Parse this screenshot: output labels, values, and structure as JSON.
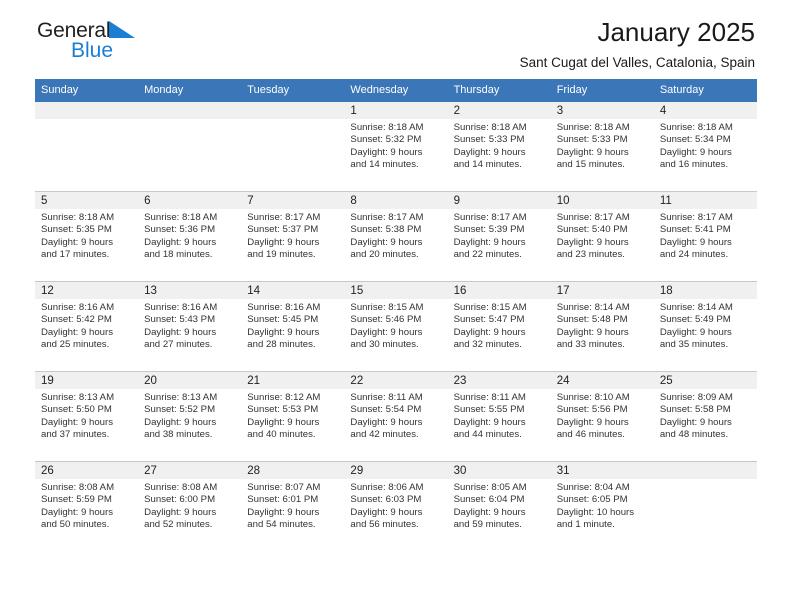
{
  "brand": {
    "name_dark": "General",
    "name_light": "Blue",
    "triangle_color": "#1a7fd4"
  },
  "header": {
    "title": "January 2025",
    "subtitle": "Sant Cugat del Valles, Catalonia, Spain"
  },
  "theme": {
    "header_bg": "#3a76b8",
    "daynum_bg": "#f0f0f0",
    "grid_line": "#c8c8c8",
    "text": "#333333"
  },
  "weekdays": [
    "Sunday",
    "Monday",
    "Tuesday",
    "Wednesday",
    "Thursday",
    "Friday",
    "Saturday"
  ],
  "weeks": [
    [
      {
        "day": "",
        "empty": true,
        "sunrise": "",
        "sunset": "",
        "daylight1": "",
        "daylight2": ""
      },
      {
        "day": "",
        "empty": true,
        "sunrise": "",
        "sunset": "",
        "daylight1": "",
        "daylight2": ""
      },
      {
        "day": "",
        "empty": true,
        "sunrise": "",
        "sunset": "",
        "daylight1": "",
        "daylight2": ""
      },
      {
        "day": "1",
        "empty": false,
        "sunrise": "Sunrise: 8:18 AM",
        "sunset": "Sunset: 5:32 PM",
        "daylight1": "Daylight: 9 hours",
        "daylight2": "and 14 minutes."
      },
      {
        "day": "2",
        "empty": false,
        "sunrise": "Sunrise: 8:18 AM",
        "sunset": "Sunset: 5:33 PM",
        "daylight1": "Daylight: 9 hours",
        "daylight2": "and 14 minutes."
      },
      {
        "day": "3",
        "empty": false,
        "sunrise": "Sunrise: 8:18 AM",
        "sunset": "Sunset: 5:33 PM",
        "daylight1": "Daylight: 9 hours",
        "daylight2": "and 15 minutes."
      },
      {
        "day": "4",
        "empty": false,
        "sunrise": "Sunrise: 8:18 AM",
        "sunset": "Sunset: 5:34 PM",
        "daylight1": "Daylight: 9 hours",
        "daylight2": "and 16 minutes."
      }
    ],
    [
      {
        "day": "5",
        "empty": false,
        "sunrise": "Sunrise: 8:18 AM",
        "sunset": "Sunset: 5:35 PM",
        "daylight1": "Daylight: 9 hours",
        "daylight2": "and 17 minutes."
      },
      {
        "day": "6",
        "empty": false,
        "sunrise": "Sunrise: 8:18 AM",
        "sunset": "Sunset: 5:36 PM",
        "daylight1": "Daylight: 9 hours",
        "daylight2": "and 18 minutes."
      },
      {
        "day": "7",
        "empty": false,
        "sunrise": "Sunrise: 8:17 AM",
        "sunset": "Sunset: 5:37 PM",
        "daylight1": "Daylight: 9 hours",
        "daylight2": "and 19 minutes."
      },
      {
        "day": "8",
        "empty": false,
        "sunrise": "Sunrise: 8:17 AM",
        "sunset": "Sunset: 5:38 PM",
        "daylight1": "Daylight: 9 hours",
        "daylight2": "and 20 minutes."
      },
      {
        "day": "9",
        "empty": false,
        "sunrise": "Sunrise: 8:17 AM",
        "sunset": "Sunset: 5:39 PM",
        "daylight1": "Daylight: 9 hours",
        "daylight2": "and 22 minutes."
      },
      {
        "day": "10",
        "empty": false,
        "sunrise": "Sunrise: 8:17 AM",
        "sunset": "Sunset: 5:40 PM",
        "daylight1": "Daylight: 9 hours",
        "daylight2": "and 23 minutes."
      },
      {
        "day": "11",
        "empty": false,
        "sunrise": "Sunrise: 8:17 AM",
        "sunset": "Sunset: 5:41 PM",
        "daylight1": "Daylight: 9 hours",
        "daylight2": "and 24 minutes."
      }
    ],
    [
      {
        "day": "12",
        "empty": false,
        "sunrise": "Sunrise: 8:16 AM",
        "sunset": "Sunset: 5:42 PM",
        "daylight1": "Daylight: 9 hours",
        "daylight2": "and 25 minutes."
      },
      {
        "day": "13",
        "empty": false,
        "sunrise": "Sunrise: 8:16 AM",
        "sunset": "Sunset: 5:43 PM",
        "daylight1": "Daylight: 9 hours",
        "daylight2": "and 27 minutes."
      },
      {
        "day": "14",
        "empty": false,
        "sunrise": "Sunrise: 8:16 AM",
        "sunset": "Sunset: 5:45 PM",
        "daylight1": "Daylight: 9 hours",
        "daylight2": "and 28 minutes."
      },
      {
        "day": "15",
        "empty": false,
        "sunrise": "Sunrise: 8:15 AM",
        "sunset": "Sunset: 5:46 PM",
        "daylight1": "Daylight: 9 hours",
        "daylight2": "and 30 minutes."
      },
      {
        "day": "16",
        "empty": false,
        "sunrise": "Sunrise: 8:15 AM",
        "sunset": "Sunset: 5:47 PM",
        "daylight1": "Daylight: 9 hours",
        "daylight2": "and 32 minutes."
      },
      {
        "day": "17",
        "empty": false,
        "sunrise": "Sunrise: 8:14 AM",
        "sunset": "Sunset: 5:48 PM",
        "daylight1": "Daylight: 9 hours",
        "daylight2": "and 33 minutes."
      },
      {
        "day": "18",
        "empty": false,
        "sunrise": "Sunrise: 8:14 AM",
        "sunset": "Sunset: 5:49 PM",
        "daylight1": "Daylight: 9 hours",
        "daylight2": "and 35 minutes."
      }
    ],
    [
      {
        "day": "19",
        "empty": false,
        "sunrise": "Sunrise: 8:13 AM",
        "sunset": "Sunset: 5:50 PM",
        "daylight1": "Daylight: 9 hours",
        "daylight2": "and 37 minutes."
      },
      {
        "day": "20",
        "empty": false,
        "sunrise": "Sunrise: 8:13 AM",
        "sunset": "Sunset: 5:52 PM",
        "daylight1": "Daylight: 9 hours",
        "daylight2": "and 38 minutes."
      },
      {
        "day": "21",
        "empty": false,
        "sunrise": "Sunrise: 8:12 AM",
        "sunset": "Sunset: 5:53 PM",
        "daylight1": "Daylight: 9 hours",
        "daylight2": "and 40 minutes."
      },
      {
        "day": "22",
        "empty": false,
        "sunrise": "Sunrise: 8:11 AM",
        "sunset": "Sunset: 5:54 PM",
        "daylight1": "Daylight: 9 hours",
        "daylight2": "and 42 minutes."
      },
      {
        "day": "23",
        "empty": false,
        "sunrise": "Sunrise: 8:11 AM",
        "sunset": "Sunset: 5:55 PM",
        "daylight1": "Daylight: 9 hours",
        "daylight2": "and 44 minutes."
      },
      {
        "day": "24",
        "empty": false,
        "sunrise": "Sunrise: 8:10 AM",
        "sunset": "Sunset: 5:56 PM",
        "daylight1": "Daylight: 9 hours",
        "daylight2": "and 46 minutes."
      },
      {
        "day": "25",
        "empty": false,
        "sunrise": "Sunrise: 8:09 AM",
        "sunset": "Sunset: 5:58 PM",
        "daylight1": "Daylight: 9 hours",
        "daylight2": "and 48 minutes."
      }
    ],
    [
      {
        "day": "26",
        "empty": false,
        "sunrise": "Sunrise: 8:08 AM",
        "sunset": "Sunset: 5:59 PM",
        "daylight1": "Daylight: 9 hours",
        "daylight2": "and 50 minutes."
      },
      {
        "day": "27",
        "empty": false,
        "sunrise": "Sunrise: 8:08 AM",
        "sunset": "Sunset: 6:00 PM",
        "daylight1": "Daylight: 9 hours",
        "daylight2": "and 52 minutes."
      },
      {
        "day": "28",
        "empty": false,
        "sunrise": "Sunrise: 8:07 AM",
        "sunset": "Sunset: 6:01 PM",
        "daylight1": "Daylight: 9 hours",
        "daylight2": "and 54 minutes."
      },
      {
        "day": "29",
        "empty": false,
        "sunrise": "Sunrise: 8:06 AM",
        "sunset": "Sunset: 6:03 PM",
        "daylight1": "Daylight: 9 hours",
        "daylight2": "and 56 minutes."
      },
      {
        "day": "30",
        "empty": false,
        "sunrise": "Sunrise: 8:05 AM",
        "sunset": "Sunset: 6:04 PM",
        "daylight1": "Daylight: 9 hours",
        "daylight2": "and 59 minutes."
      },
      {
        "day": "31",
        "empty": false,
        "sunrise": "Sunrise: 8:04 AM",
        "sunset": "Sunset: 6:05 PM",
        "daylight1": "Daylight: 10 hours",
        "daylight2": "and 1 minute."
      },
      {
        "day": "",
        "empty": true,
        "sunrise": "",
        "sunset": "",
        "daylight1": "",
        "daylight2": ""
      }
    ]
  ]
}
